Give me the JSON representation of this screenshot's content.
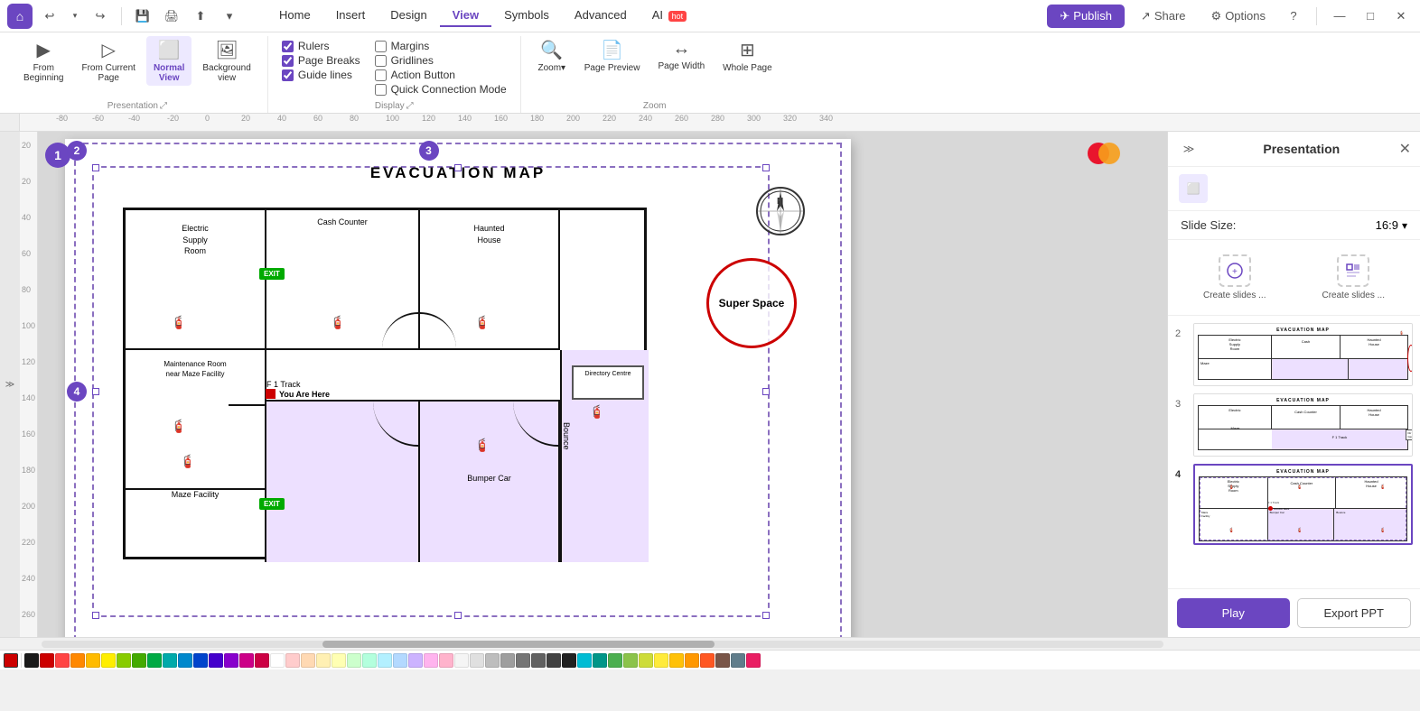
{
  "titlebar": {
    "home_icon": "⌂",
    "undo": "↩",
    "redo": "↪",
    "save_icon": "💾",
    "print_icon": "🖨",
    "share_label": "Share",
    "publish_label": "Publish",
    "options_label": "Options",
    "help_icon": "?",
    "close_icon": "✕",
    "minimize_icon": "—",
    "maximize_icon": "□"
  },
  "menu": {
    "tabs": [
      "Home",
      "Insert",
      "Design",
      "View",
      "Symbols",
      "Advanced",
      "AI"
    ],
    "active_tab": "View",
    "ai_badge": "hot"
  },
  "ribbon": {
    "presentation_group": {
      "label": "Presentation",
      "buttons": [
        {
          "id": "from-beginning",
          "icon": "▶",
          "label": "From\nBeginning"
        },
        {
          "id": "from-current",
          "icon": "▷",
          "label": "From Current\nPage"
        },
        {
          "id": "normal-view",
          "icon": "⬜",
          "label": "Normal\nView",
          "active": true
        },
        {
          "id": "background-view",
          "icon": "🖼",
          "label": "Background\nview"
        }
      ]
    },
    "display_group": {
      "label": "Display",
      "checkboxes": [
        {
          "id": "rulers",
          "label": "Rulers",
          "checked": true
        },
        {
          "id": "page-breaks",
          "label": "Page Breaks",
          "checked": true
        },
        {
          "id": "guide-lines",
          "label": "Guide lines",
          "checked": true
        },
        {
          "id": "margins",
          "label": "Margins",
          "checked": false
        },
        {
          "id": "gridlines",
          "label": "Gridlines",
          "checked": false
        },
        {
          "id": "action-button",
          "label": "Action Button",
          "checked": false
        },
        {
          "id": "quick-connection",
          "label": "Quick Connection Mode",
          "checked": false
        }
      ]
    },
    "zoom_group": {
      "label": "Zoom",
      "buttons": [
        {
          "id": "zoom",
          "icon": "🔍",
          "label": "Zoom▾"
        },
        {
          "id": "page-preview",
          "icon": "📄",
          "label": "Page Preview"
        },
        {
          "id": "page-width",
          "icon": "↔",
          "label": "Page Width"
        },
        {
          "id": "whole-page",
          "icon": "⊞",
          "label": "Whole Page"
        }
      ]
    }
  },
  "right_panel": {
    "title": "Presentation",
    "slide_size_label": "Slide Size:",
    "slide_size_value": "16:9",
    "create_slides_from_ai": "Create slides ...",
    "create_slides_template": "Create slides ...",
    "slides": [
      {
        "num": 2,
        "active": false
      },
      {
        "num": 3,
        "active": false
      },
      {
        "num": 4,
        "active": true
      }
    ],
    "play_label": "Play",
    "export_label": "Export PPT"
  },
  "canvas": {
    "slide_badges": [
      "1",
      "2",
      "3",
      "4"
    ],
    "evacuation_title": "EVACUATION MAP",
    "rooms": [
      {
        "name": "Electric\nSupply\nRoom"
      },
      {
        "name": "Cash Counter"
      },
      {
        "name": "Haunted\nHouse"
      },
      {
        "name": "Maintenance Room\nnear Maze Facility"
      },
      {
        "name": "Maze Facility"
      },
      {
        "name": "Bumper Car"
      },
      {
        "name": "Bounce"
      }
    ],
    "super_space": "Super Space",
    "f1_track": "F 1 Track",
    "you_are_here": "You Are Here",
    "directory": "Directory\nCentre"
  },
  "colors": {
    "accent": "#6b46c1",
    "active_border": "#6b46c1",
    "dashed_border": "#7b5ea7",
    "super_space_border": "#cc0000"
  },
  "swatches": [
    "#1a1a1a",
    "#cc0000",
    "#ff4444",
    "#ff8800",
    "#ffbb00",
    "#ffee00",
    "#88cc00",
    "#44aa00",
    "#00aa44",
    "#00aaaa",
    "#0088cc",
    "#0044cc",
    "#4400cc",
    "#8800cc",
    "#cc0088",
    "#cc0044",
    "#ffffff",
    "#ffcccc",
    "#ffd9b3",
    "#fff0b3",
    "#ffffb3",
    "#ccffcc",
    "#b3ffdd",
    "#b3f0ff",
    "#b3d9ff",
    "#ccb3ff",
    "#ffb3ee",
    "#ffb3cc",
    "#f5f5f5",
    "#e0e0e0",
    "#bdbdbd",
    "#9e9e9e",
    "#757575",
    "#616161",
    "#424242",
    "#212121",
    "#00bcd4",
    "#009688",
    "#4caf50",
    "#8bc34a",
    "#cddc39",
    "#ffeb3b",
    "#ffc107",
    "#ff9800",
    "#ff5722",
    "#795548",
    "#607d8b",
    "#e91e63"
  ]
}
